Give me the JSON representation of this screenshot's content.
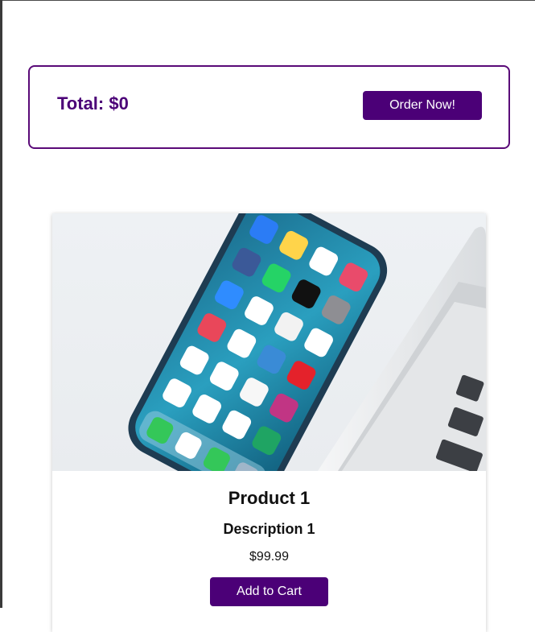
{
  "cart": {
    "total_label": "Total: $0",
    "order_button_label": "Order Now!"
  },
  "products": [
    {
      "title": "Product 1",
      "description": "Description 1",
      "price": "$99.99",
      "add_button_label": "Add to Cart",
      "image_icon": "smartphone-on-laptop-photo"
    }
  ],
  "colors": {
    "accent": "#4b0077",
    "border": "#5a0a78",
    "text": "#111111",
    "background": "#ffffff"
  }
}
